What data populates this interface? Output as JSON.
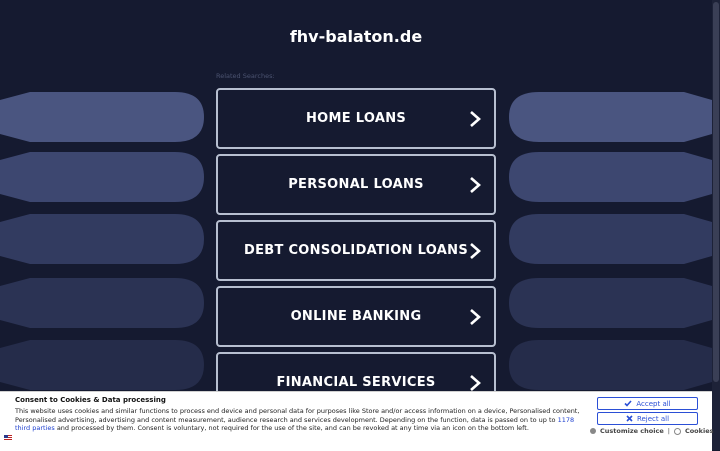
{
  "header": {
    "site_title": "fhv-balaton.de",
    "related_label": "Related Searches:"
  },
  "links": [
    {
      "label": "HOME LOANS"
    },
    {
      "label": "PERSONAL LOANS"
    },
    {
      "label": "DEBT CONSOLIDATION LOANS"
    },
    {
      "label": "ONLINE BANKING"
    },
    {
      "label": "FINANCIAL SERVICES"
    }
  ],
  "consent": {
    "title": "Consent to Cookies & Data processing",
    "text_part1": "This website uses cookies and similar functions to process end device and personal data for purposes like Store and/or access information on a device, Personalised content, Personalised advertising, advertising and content measurement, audience research and services development. Depending on the function, data is passed on to up to ",
    "link_text": "1178 third parties",
    "text_part2": " and processed by them. Consent is voluntary, not required for the use of the site, and can be revoked at any time via an icon on the bottom left.",
    "accept_label": "Accept all",
    "reject_label": "Reject all",
    "customize_label": "Customize choice",
    "separator": "|",
    "cookies_label": "Cookies"
  },
  "colors": {
    "background": "#151a30",
    "deco_top": "#4a5580",
    "deco_bottom": "#232a48",
    "accent_blue": "#2b4fd6"
  }
}
